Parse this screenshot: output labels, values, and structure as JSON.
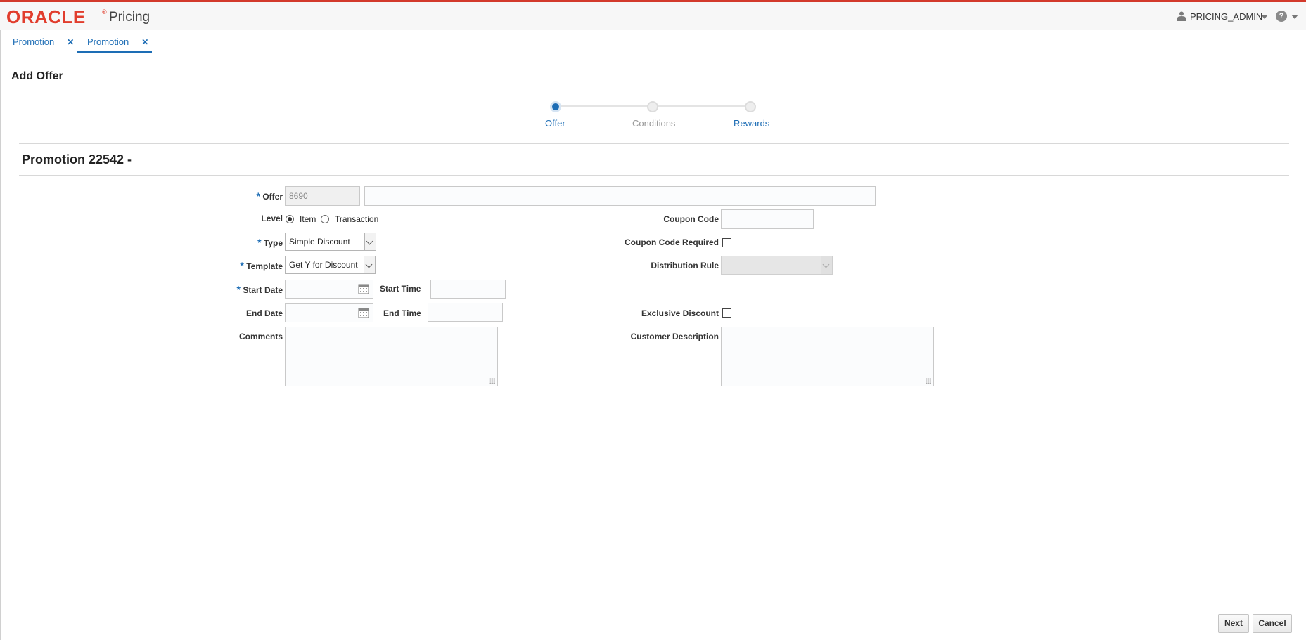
{
  "header": {
    "logo_text": "ORACLE",
    "logo_reg": "®",
    "app_name": "Pricing",
    "user_name": "PRICING_ADMIN",
    "help_glyph": "?"
  },
  "tabs": [
    {
      "label": "Promotion",
      "close": "✕",
      "active": false
    },
    {
      "label": "Promotion",
      "close": "✕",
      "active": true
    }
  ],
  "page": {
    "title": "Add Offer",
    "promotion_title": "Promotion 22542  -"
  },
  "train": {
    "steps": [
      "Offer",
      "Conditions",
      "Rewards"
    ],
    "active_step": "Offer"
  },
  "form": {
    "required_marker": "*",
    "offer": {
      "label": "Offer",
      "id_value": "8690",
      "name_value": ""
    },
    "level": {
      "label": "Level",
      "options": [
        "Item",
        "Transaction"
      ],
      "selected": "Item"
    },
    "type": {
      "label": "Type",
      "value": "Simple Discount"
    },
    "template": {
      "label": "Template",
      "value": "Get Y for Discount"
    },
    "start_date": {
      "label": "Start Date",
      "value": ""
    },
    "start_time": {
      "label": "Start Time",
      "value": ""
    },
    "end_date": {
      "label": "End Date",
      "value": ""
    },
    "end_time": {
      "label": "End Time",
      "value": ""
    },
    "comments": {
      "label": "Comments",
      "value": ""
    },
    "coupon_code": {
      "label": "Coupon Code",
      "value": ""
    },
    "coupon_code_required": {
      "label": "Coupon Code Required",
      "checked": false
    },
    "distribution_rule": {
      "label": "Distribution Rule",
      "value": "",
      "disabled": true
    },
    "exclusive_discount": {
      "label": "Exclusive Discount",
      "checked": false
    },
    "customer_description": {
      "label": "Customer Description",
      "value": ""
    }
  },
  "footer": {
    "next_label": "Next",
    "cancel_label": "Cancel"
  },
  "colors": {
    "accent": "#1d6db5",
    "brand_red": "#e13d2d",
    "top_border": "#d33a2c"
  },
  "icons": [
    "user-icon",
    "help-icon",
    "close-icon",
    "calendar-icon",
    "chevron-down-icon"
  ]
}
